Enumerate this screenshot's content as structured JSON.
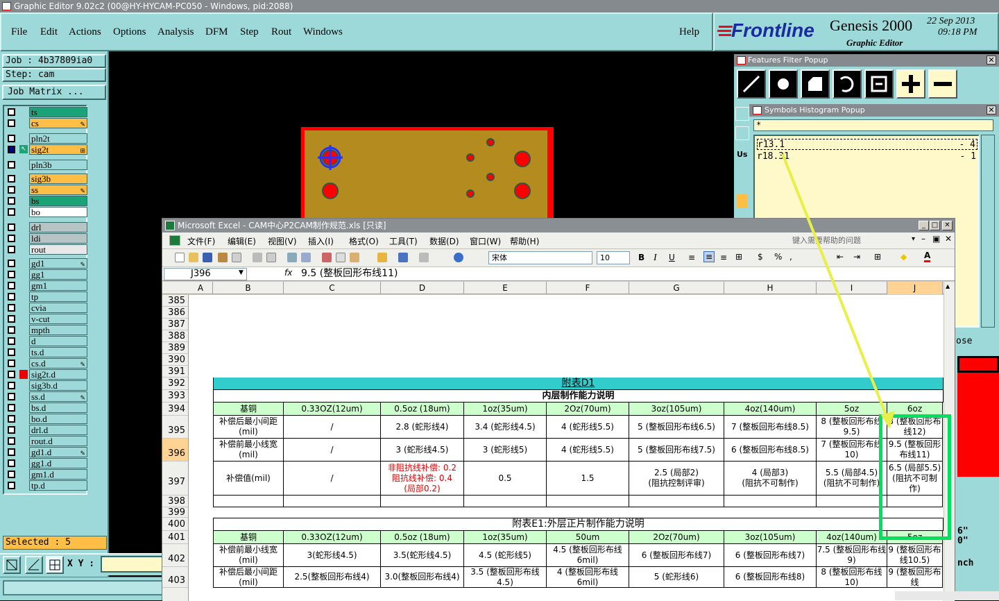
{
  "ge_window": {
    "title": "Graphic Editor 9.02c2 (00@HY-HYCAM-PC050 - Windows, pid:2088)"
  },
  "menu": {
    "items": [
      "File",
      "Edit",
      "Actions",
      "Options",
      "Analysis",
      "DFM",
      "Step",
      "Rout",
      "Windows"
    ],
    "help": "Help"
  },
  "brand": {
    "logo": "Frontline",
    "product": "Genesis 2000",
    "subtitle": "Graphic Editor",
    "date": "22 Sep 2013",
    "time": "09:18 PM"
  },
  "job": {
    "job_label": "Job : 4b37809ia0",
    "step_label": "Step: cam",
    "matrix_button": "Job Matrix ..."
  },
  "layers": [
    {
      "name": "ts",
      "color": "#1aa376"
    },
    {
      "name": "cs",
      "color": "#ffbe45",
      "mark": "✎"
    },
    {
      "name": "pln2t",
      "color": "#9ed9d9"
    },
    {
      "name": "sig2t",
      "color": "#ffbe45",
      "mark": "⊞"
    },
    {
      "name": "pln3b",
      "color": "#9ed9d9"
    },
    {
      "name": "sig3b",
      "color": "#ffbe45"
    },
    {
      "name": "ss",
      "color": "#ffbe45",
      "mark": "✎"
    },
    {
      "name": "bs",
      "color": "#1aa376"
    },
    {
      "name": "bo",
      "color": "#ffffff"
    },
    {
      "name": "drl",
      "color": "#b8c4c4"
    },
    {
      "name": "ldi",
      "color": "#b8c4c4"
    },
    {
      "name": "rout",
      "color": "#e8e8e8"
    },
    {
      "name": "gd1",
      "color": "#9ed9d9",
      "mark": "✎"
    },
    {
      "name": "gg1",
      "color": "#9ed9d9"
    },
    {
      "name": "gm1",
      "color": "#9ed9d9"
    },
    {
      "name": "tp",
      "color": "#9ed9d9"
    },
    {
      "name": "cvia",
      "color": "#9ed9d9"
    },
    {
      "name": "v-cut",
      "color": "#9ed9d9"
    },
    {
      "name": "mpth",
      "color": "#9ed9d9"
    },
    {
      "name": "d",
      "color": "#9ed9d9"
    },
    {
      "name": "ts.d",
      "color": "#9ed9d9"
    },
    {
      "name": "cs.d",
      "color": "#9ed9d9",
      "mark": "✎"
    },
    {
      "name": "sig2t.d",
      "color": "#9ed9d9"
    },
    {
      "name": "sig3b.d",
      "color": "#9ed9d9"
    },
    {
      "name": "ss.d",
      "color": "#9ed9d9",
      "mark": "✎"
    },
    {
      "name": "bs.d",
      "color": "#9ed9d9"
    },
    {
      "name": "bo.d",
      "color": "#9ed9d9"
    },
    {
      "name": "drl.d",
      "color": "#9ed9d9"
    },
    {
      "name": "rout.d",
      "color": "#9ed9d9"
    },
    {
      "name": "gd1.d",
      "color": "#9ed9d9",
      "mark": "✎"
    },
    {
      "name": "gg1.d",
      "color": "#9ed9d9"
    },
    {
      "name": "gm1.d",
      "color": "#9ed9d9"
    },
    {
      "name": "tp.d",
      "color": "#9ed9d9"
    }
  ],
  "status": {
    "selected": "Selected : 5",
    "xy_label": "X Y :"
  },
  "features_filter": {
    "title": "Features Filter Popup"
  },
  "symbols_histogram": {
    "title": "Symbols Histogram Popup",
    "filter": "*",
    "rows": [
      {
        "symbol": "r13.1",
        "count": "- 4"
      },
      {
        "symbol": "r18.31",
        "count": "- 1"
      }
    ]
  },
  "right_labels": {
    "close": "ose",
    "unit": "nch",
    "dim": "6\"",
    "dim2": "0\"",
    "us": "Us"
  },
  "excel": {
    "title": "Microsoft Excel - CAM中心P2CAM制作规范.xls [只读]",
    "menu": [
      "文件(F)",
      "编辑(E)",
      "视图(V)",
      "插入(I)",
      "格式(O)",
      "工具(T)",
      "数据(D)",
      "窗口(W)",
      "帮助(H)"
    ],
    "help_placeholder": "键入需要帮助的问题",
    "font": "宋体",
    "font_size": "10",
    "cell_ref": "J396",
    "formula": "9.5 (整板回形布线11)",
    "columns": [
      "A",
      "B",
      "C",
      "D",
      "E",
      "F",
      "G",
      "H",
      "I",
      "J"
    ],
    "rows": [
      "385",
      "386",
      "387",
      "388",
      "389",
      "390",
      "391",
      "392",
      "393",
      "394",
      "395",
      "396",
      "397",
      "398",
      "399",
      "400",
      "401",
      "402",
      "403"
    ],
    "table_d1": {
      "title": "附表D1",
      "subtitle": "内层制作能力说明",
      "header": [
        "基铜",
        "0.33OZ(12um)",
        "0.5oz (18um)",
        "1oz(35um)",
        "2Oz(70um)",
        "3oz(105um)",
        "4oz(140um)",
        "5oz",
        "6oz"
      ],
      "r395": [
        "补偿后最小间距(mil)",
        "/",
        "2.8 (蛇形线4)",
        "3.4 (蛇形线4.5)",
        "4 (蛇形线5.5)",
        "5 (整板回形布线6.5)",
        "7 (整板回形布线8.5)",
        "8 (整板回形布线9.5)",
        "8 (整板回形布线12)"
      ],
      "r396": [
        "补偿前最小线宽(mil)",
        "/",
        "3 (蛇形线4.5)",
        "3 (蛇形线5)",
        "4 (蛇形线5.5)",
        "5 (整板回形布线7.5)",
        "6 (整板回形布线8.5)",
        "7 (整板回形布线10)",
        "9.5 (整板回形布线11)"
      ],
      "r397": [
        "补偿值(mil)",
        "/",
        "非阻抗线补偿: 0.2\n阻抗线补偿: 0.4\n(局部0.2)",
        "0.5",
        "1.5",
        "2.5 (局部2)\n(阻抗控制评审)",
        "4 (局部3)\n(阻抗不可制作)",
        "5.5 (局部4.5)\n(阻抗不可制作)",
        "6.5 (局部5.5)\n(阻抗不可制作)"
      ]
    },
    "table_e1": {
      "title": "附表E1:外层正片制作能力说明",
      "header": [
        "基铜",
        "0.33OZ(12um)",
        "0.5oz (18um)",
        "1oz(35um)",
        "50um",
        "2Oz(70um)",
        "3oz(105um)",
        "4oz(140um)",
        "5oz"
      ],
      "r402": [
        "补偿前最小线宽(mil)",
        "3(蛇形线4.5)",
        "3.5(蛇形线4.5)",
        "4.5 (蛇形线5)",
        "4.5 (整板回形布线6mil)",
        "6 (整板回形布线7)",
        "6 (整板回形布线7)",
        "7.5 (整板回形布线9)",
        "9 (整板回形布线10.5)"
      ],
      "r403": [
        "补偿后最小间距(mil)",
        "2.5(整板回形布线4)",
        "3.0(整板回形布线4)",
        "3.5 (整板回形布线4.5)",
        "4 (整板回形布线6mil)",
        "5 (蛇形线6)",
        "6 (整板回形布线8)",
        "8 (整板回形布线10)",
        "9 (整板回形布线"
      ]
    }
  },
  "colors": {
    "panel": "#9ed9d9",
    "accent_orange": "#ffbe45",
    "teal_layer": "#1aa376",
    "pcb_board": "#b38b1f",
    "pcb_pad": "#ff0000",
    "highlight_green": "#00e060",
    "arrow_yellow": "#e8f048"
  }
}
